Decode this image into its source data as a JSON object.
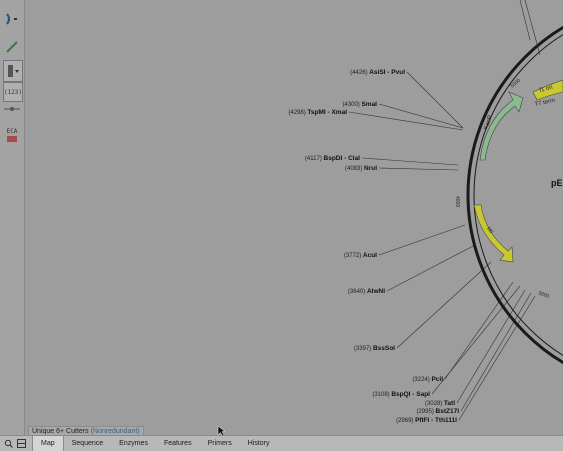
{
  "left_toolbar": {
    "count_badge": "(123)",
    "feature_label": "ECA"
  },
  "map": {
    "plasmid_title": "pE",
    "sites": [
      {
        "pos": "(4426)",
        "name": "AsiSI - PvuI"
      },
      {
        "pos": "(4300)",
        "name": "SmaI"
      },
      {
        "pos": "(4298)",
        "name": "TspMI - XmaI"
      },
      {
        "pos": "(4117)",
        "name": "BspDI - ClaI"
      },
      {
        "pos": "(4083)",
        "name": "NruI"
      },
      {
        "pos": "(3772)",
        "name": "AcuI"
      },
      {
        "pos": "(3640)",
        "name": "AlwNI"
      },
      {
        "pos": "(3397)",
        "name": "BssSoI"
      },
      {
        "pos": "(3224)",
        "name": "PciI"
      },
      {
        "pos": "(3108)",
        "name": "BspQI - SapI"
      },
      {
        "pos": "(3028)",
        "name": "TatI"
      },
      {
        "pos": "(2995)",
        "name": "BstZ17I"
      },
      {
        "pos": "(2969)",
        "name": "PflFI - Tth111I"
      }
    ],
    "features": {
      "f1_ori": "f1 ori",
      "t7_term": "T7 term",
      "kanr": "KanR",
      "ori": "ori"
    },
    "ticks": {
      "t5000": "5000",
      "t4000": "4000",
      "t3000": "3000"
    }
  },
  "legend": {
    "label": "Unique 6+ Cutters",
    "qualifier": "(Nonredundant)"
  },
  "tabs": [
    {
      "label": "Map",
      "active": true
    },
    {
      "label": "Sequence",
      "active": false
    },
    {
      "label": "Enzymes",
      "active": false
    },
    {
      "label": "Features",
      "active": false
    },
    {
      "label": "Primers",
      "active": false
    },
    {
      "label": "History",
      "active": false
    }
  ]
}
